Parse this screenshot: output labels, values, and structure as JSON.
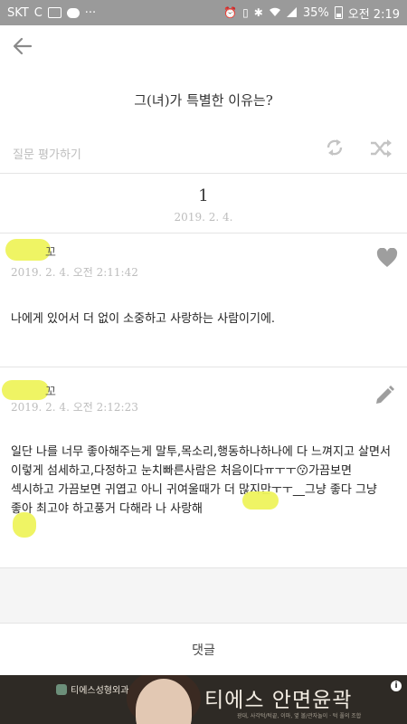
{
  "status_bar": {
    "carrier": "SKT",
    "carrier_extra": "C",
    "more_indicator": "···",
    "battery": "35%",
    "time": "오전 2:19",
    "icons": [
      "image-icon",
      "message-icon",
      "alarm-icon",
      "vibrate-icon",
      "bluetooth-icon",
      "wifi-icon",
      "signal-icon",
      "battery-icon"
    ]
  },
  "header": {
    "question": "그(녀)가 특별한 이유는?",
    "rate_label": "질문 평가하기"
  },
  "summary": {
    "count": "1",
    "date": "2019. 2. 4."
  },
  "answers": [
    {
      "author_suffix": "꼬",
      "meta": "2019. 2. 4. 오전 2:11:42",
      "text": "나에게 있어서 더 없이 소중하고 사랑하는 사람이기에."
    },
    {
      "author_suffix": "꼬",
      "meta": "2019. 2. 4. 오전 2:12:23",
      "text": "일단 나를 너무 좋아해주는게 말투,목소리,행동하나하나에 다 느껴지고 살면서 이렇게 섬세하고,다정하고 눈치빠른사람은 처음이다ㅠㅜㅜ😗가끔보면 섹시하고 가끔보면 귀엽고 아니 귀여울때가 더 많지만ㅜㅜ__그냥 좋다 그냥 좋아 최고야 하고풍거 다해라 나 사랑해"
    }
  ],
  "comment_label": "댓글",
  "ad": {
    "brand": "티에스성형외과",
    "headline": "티에스 안면윤곽",
    "sub": "광대, 사각턱/턱끝, 이마, 옆 볼/관자놀이 · 턱 풀의 조합",
    "info": "i"
  },
  "colors": {
    "status_bar": "#9a9a9a",
    "highlight": "#eef35c",
    "muted_text": "#bdbdbd",
    "ad_background": "#2e2a25"
  }
}
